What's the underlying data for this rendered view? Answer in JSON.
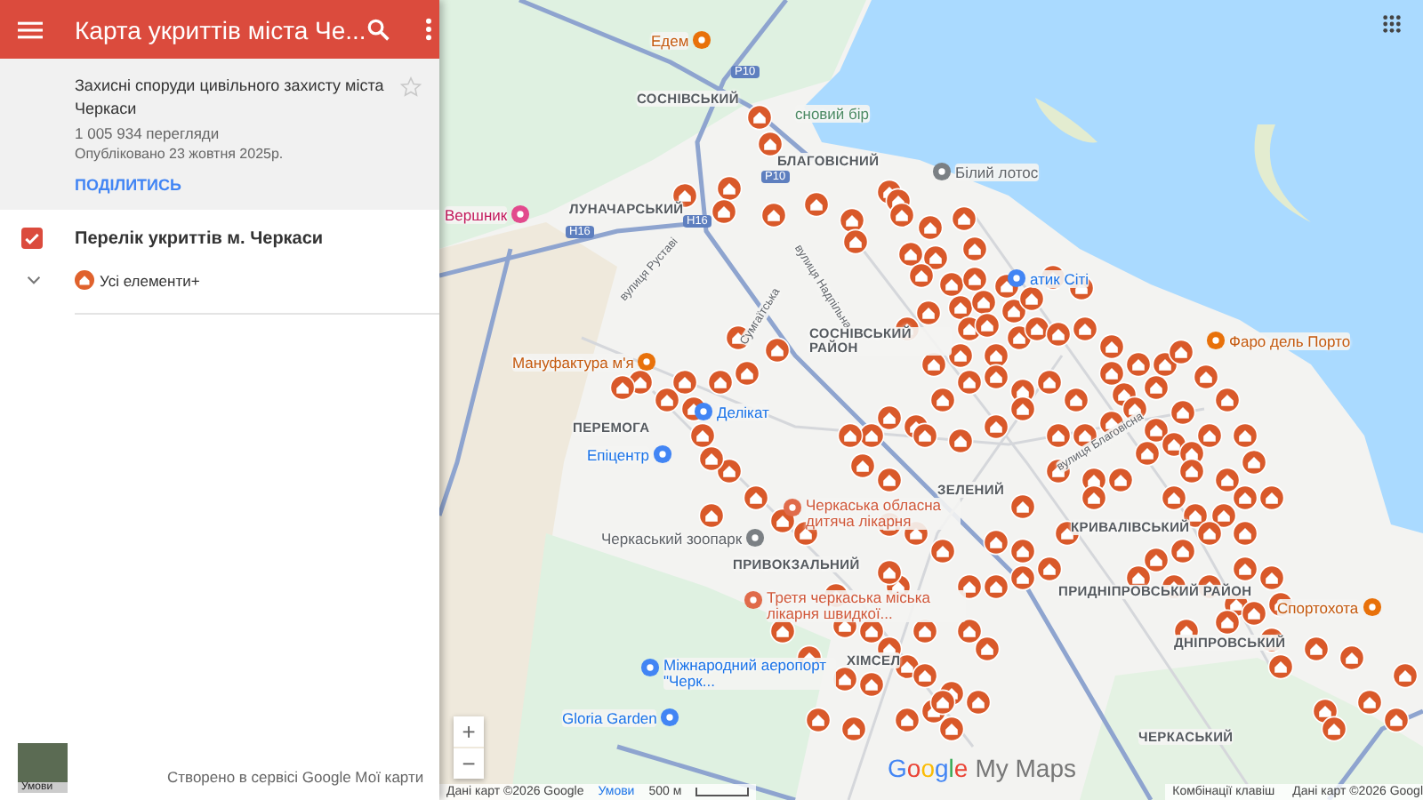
{
  "header": {
    "title": "Карта укриттів міста Че..."
  },
  "map_info": {
    "title": "Захисні споруди цивільного захисту міста Черкаси",
    "views": "1 005 934 перегляди",
    "published": "Опубліковано 23 жовтня 2025р.",
    "share": "ПОДІЛИТИСЬ",
    "starred": false
  },
  "layers": [
    {
      "name": "Перелік укриттів м. Черкаси",
      "checked": true,
      "style_label": "Усі елементи+"
    }
  ],
  "footer": {
    "thumbnail_label": "Умови",
    "credit": "Створено в сервісі Google Мої карти"
  },
  "map": {
    "labels": [
      {
        "text": "Едем",
        "kind": "food"
      },
      {
        "text": "СОСНІВСЬКИЙ",
        "kind": "district"
      },
      {
        "text": "сновий бір",
        "kind": "park"
      },
      {
        "text": "БЛАГОВІСНИЙ",
        "kind": "district"
      },
      {
        "text": "Білий лотос",
        "kind": "landmark"
      },
      {
        "text": "Вершник",
        "kind": "hotel"
      },
      {
        "text": "ЛУНАЧАРСЬКИЙ",
        "kind": "district"
      },
      {
        "text": "Р10",
        "kind": "shield"
      },
      {
        "text": "Р10",
        "kind": "shield"
      },
      {
        "text": "Н16",
        "kind": "shield"
      },
      {
        "text": "Н16",
        "kind": "shield"
      },
      {
        "text": "вулиця Руставі",
        "kind": "street"
      },
      {
        "text": "вулиця Надпільна",
        "kind": "street"
      },
      {
        "text": "Сумгаїтська",
        "kind": "street"
      },
      {
        "text": "атик Сіті",
        "kind": "shop"
      },
      {
        "text": "СОСНІВСЬКИЙ РАЙОН",
        "kind": "district"
      },
      {
        "text": "Фаро дель Порто",
        "kind": "food"
      },
      {
        "text": "Мануфактура м'я",
        "kind": "food"
      },
      {
        "text": "ПЕРЕМОГА",
        "kind": "district"
      },
      {
        "text": "Делікат",
        "kind": "shop"
      },
      {
        "text": "Епіцентр",
        "kind": "shop"
      },
      {
        "text": "Черкаська обласна дитяча лікарня",
        "kind": "medical"
      },
      {
        "text": "Черкаський зоопарк",
        "kind": "landmark"
      },
      {
        "text": "ПРИВОКЗАЛЬНИЙ",
        "kind": "district"
      },
      {
        "text": "ЗЕЛЕНИЙ",
        "kind": "district"
      },
      {
        "text": "КРИВАЛІВСЬКИЙ",
        "kind": "district"
      },
      {
        "text": "ПРИДНІПРОВСЬКИЙ РАЙОН",
        "kind": "district"
      },
      {
        "text": "Третя черкаська міська лікарня швидкої...",
        "kind": "medical"
      },
      {
        "text": "Спортохота",
        "kind": "food"
      },
      {
        "text": "ДНІПРОВСЬКИЙ",
        "kind": "district"
      },
      {
        "text": "ХІМСЕЛ",
        "kind": "district"
      },
      {
        "text": "Міжнародний аеропорт \"Черк...",
        "kind": "airport"
      },
      {
        "text": "Gloria Garden",
        "kind": "shop"
      },
      {
        "text": "ЧЕРКАСЬКИЙ",
        "kind": "district"
      },
      {
        "text": "вулиця Благовісна",
        "kind": "street"
      }
    ],
    "zoom_in": "+",
    "zoom_out": "−",
    "logo_brand": "Google",
    "logo_product": "My Maps",
    "attribution_left": "Дані карт ©2026 Google",
    "terms": "Умови",
    "scale": "500 м",
    "shortcuts": "Комбінації клавіш",
    "attribution_right": "Дані карт ©2026 Googl"
  }
}
